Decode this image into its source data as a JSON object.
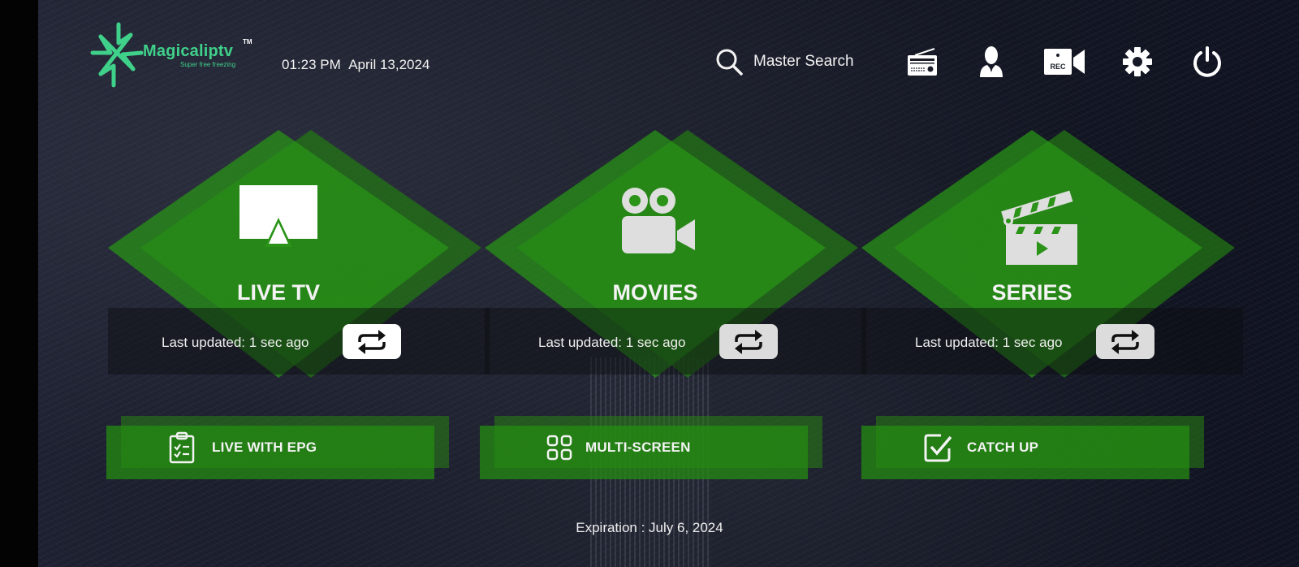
{
  "app": {
    "brand_name": "Magicaliptv",
    "brand_tm": "TM",
    "brand_tagline": "Super free freezing",
    "brand_color": "#3fd08a"
  },
  "header": {
    "time": "01:23 PM",
    "date": "April 13,2024",
    "search_label": "Master Search",
    "icons": [
      {
        "name": "radio-icon",
        "label": "Radio"
      },
      {
        "name": "user-icon",
        "label": "Account"
      },
      {
        "name": "rec-camera-icon",
        "label": "REC"
      },
      {
        "name": "gear-icon",
        "label": "Settings"
      },
      {
        "name": "power-icon",
        "label": "Power"
      }
    ],
    "rec_text": "REC"
  },
  "tiles": [
    {
      "id": "live-tv",
      "label": "LIVE TV",
      "icon": "cast-screen-icon",
      "updated": "Last updated: 1 sec ago",
      "refresh_active": true
    },
    {
      "id": "movies",
      "label": "MOVIES",
      "icon": "movie-camera-icon",
      "updated": "Last updated: 1 sec ago",
      "refresh_active": false
    },
    {
      "id": "series",
      "label": "SERIES",
      "icon": "clapperboard-icon",
      "updated": "Last updated: 1 sec ago",
      "refresh_active": false
    }
  ],
  "bottom_buttons": [
    {
      "id": "live-with-epg",
      "label": "LIVE WITH EPG",
      "icon": "clipboard-checklist-icon"
    },
    {
      "id": "multi-screen",
      "label": "MULTI-SCREEN",
      "icon": "grid-four-icon"
    },
    {
      "id": "catch-up",
      "label": "CATCH UP",
      "icon": "checkbox-icon"
    }
  ],
  "footer": {
    "expiration": "Expiration : July 6, 2024"
  },
  "colors": {
    "tile_green": "#2a8a1a",
    "button_green": "#248c12",
    "refresh_active_bg": "#ffffff",
    "refresh_inactive_bg": "#dcdcdc"
  }
}
